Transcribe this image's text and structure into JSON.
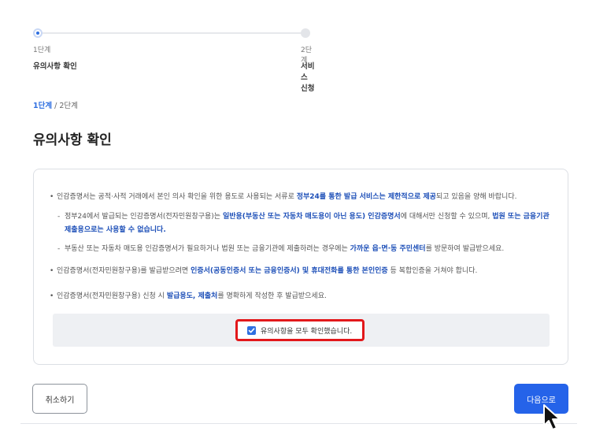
{
  "stepper": {
    "steps": [
      {
        "number": "1단계",
        "name": "유의사항 확인"
      },
      {
        "number": "2단계",
        "name": "서비스 신청"
      }
    ]
  },
  "breadcrumb": {
    "current": "1단계",
    "separator": " / ",
    "total": "2단계"
  },
  "page_title": "유의사항 확인",
  "notice": {
    "p1": {
      "a": "인감증명서는 공적·사적 거래에서 본인 의사 확인을 위한 용도로 사용되는 서류로 ",
      "b": "정부24를 통한 발급 서비스는 제한적으로 제공",
      "c": "되고 있음을 양해 바랍니다."
    },
    "p2": {
      "a": "정부24에서 발급되는 인감증명서(전자민원창구용)는 ",
      "b": "일반용(부동산 또는 자동차 매도용이 아닌 용도) 인감증명서",
      "c": "에 대해서만 신청할 수 있으며, ",
      "d": "법원 또는 금융기관 제출용으로는 사용할 수 없습니다."
    },
    "p3": {
      "a": "부동산 또는 자동차 매도용 인감증명서가 필요하거나 법원 또는 금융기관에 제출하려는 경우에는 ",
      "b": "가까운 읍·면·동 주민센터",
      "c": "를 방문하여 발급받으세요."
    },
    "p4": {
      "a": "인감증명서(전자민원창구용)를 발급받으려면 ",
      "b": "인증서(공동인증서 또는 금융인증서) 및 휴대전화를 통한 본인인증",
      "c": " 등 복합인증을 거쳐야 합니다."
    },
    "p5": {
      "a": "인감증명서(전자민원창구용) 신청 시 ",
      "b": "발급용도, 제출처",
      "c": "를 명확하게 작성한 후 발급받으세요."
    }
  },
  "confirm": {
    "label": "유의사항을 모두 확인했습니다.",
    "checked": true
  },
  "buttons": {
    "cancel": "취소하기",
    "next": "다음으로"
  },
  "colors": {
    "accent": "#2563e9",
    "highlight": "#e2181b",
    "emphasis": "#1d4fb8"
  }
}
